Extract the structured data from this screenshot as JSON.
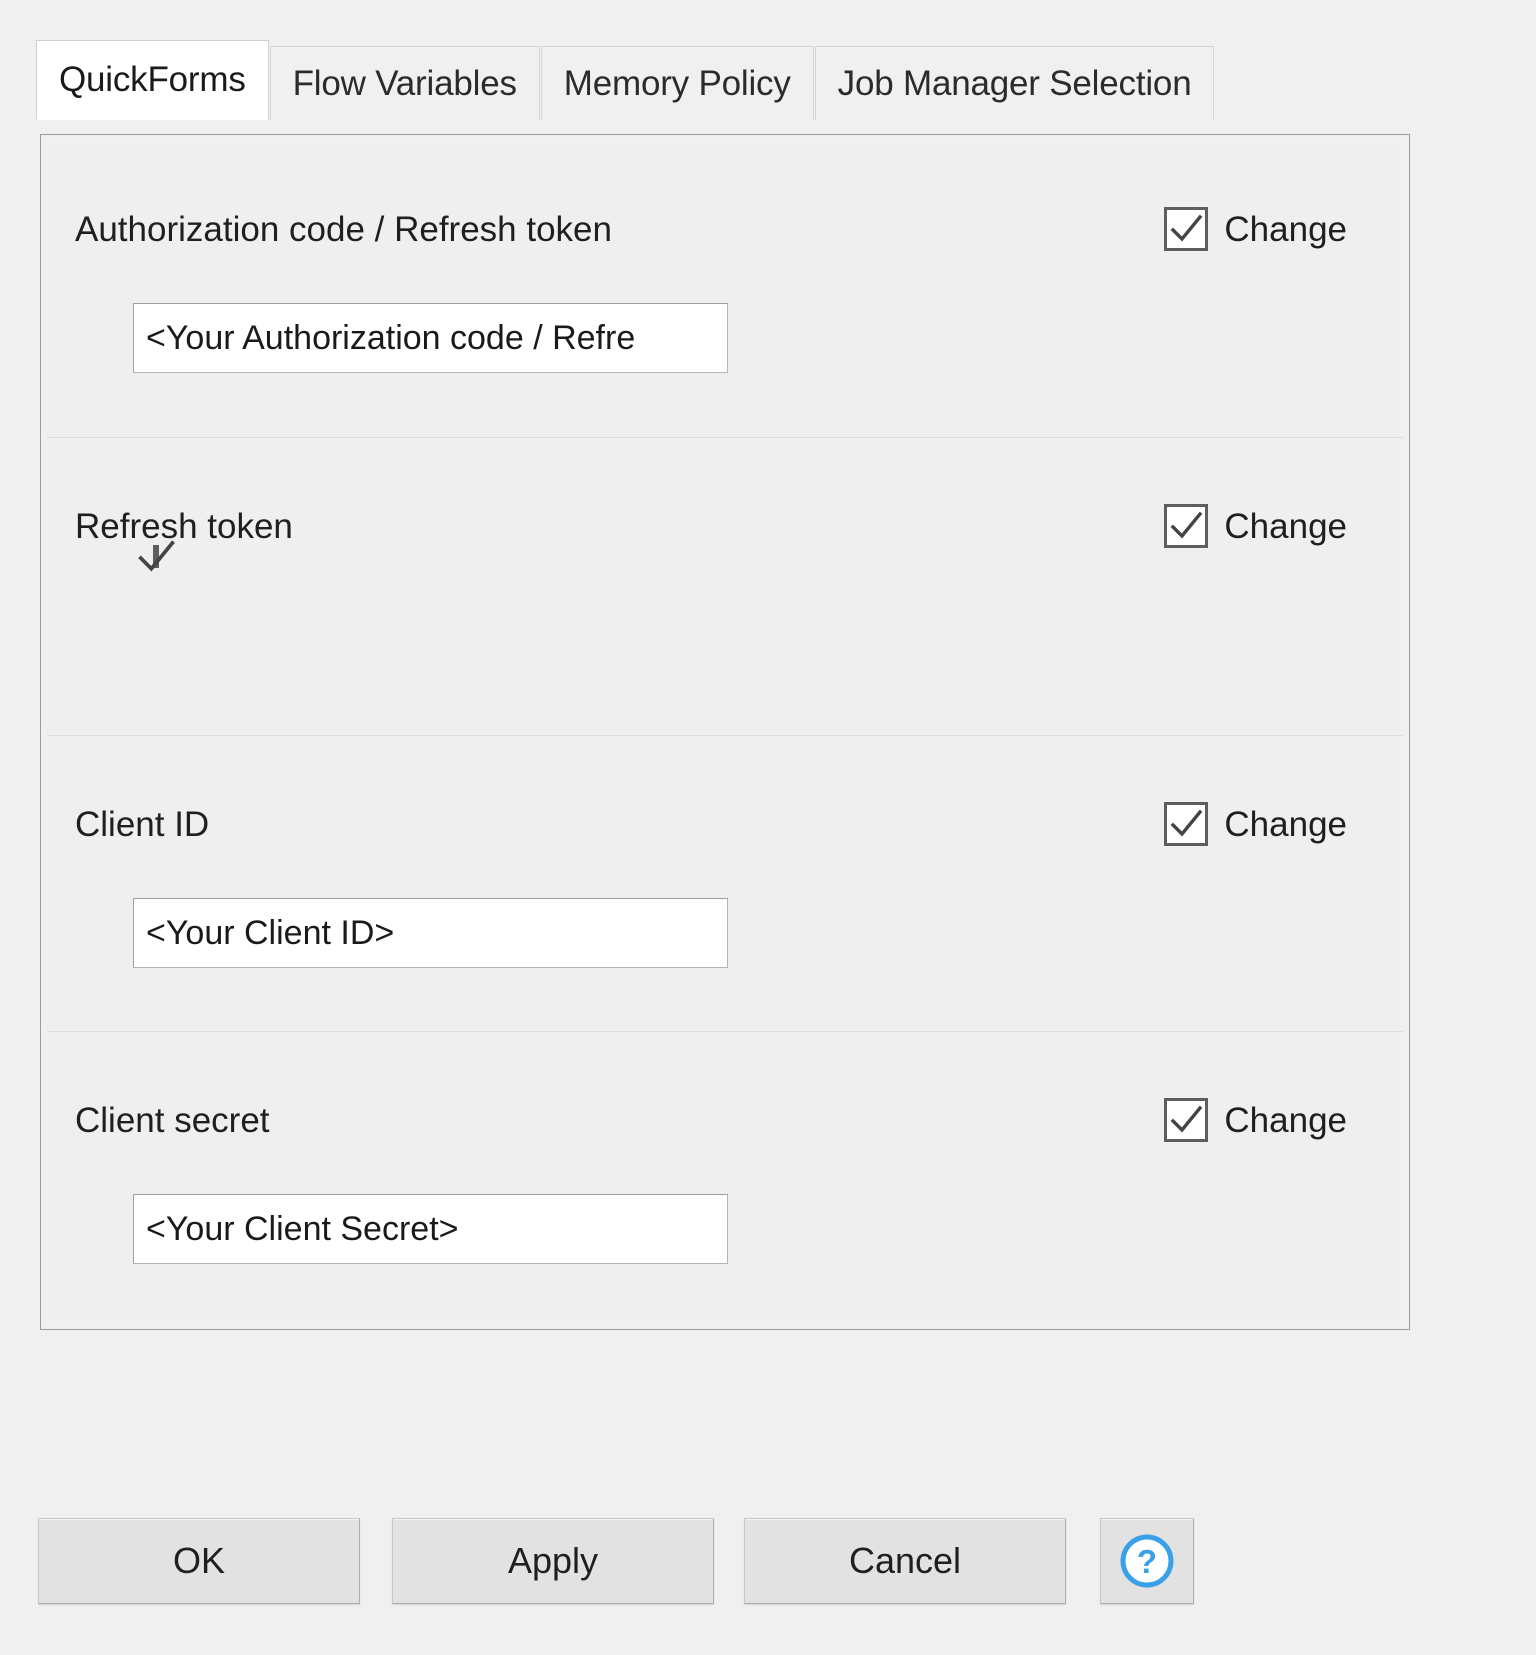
{
  "tabs": [
    {
      "label": "QuickForms",
      "active": true
    },
    {
      "label": "Flow Variables",
      "active": false
    },
    {
      "label": "Memory Policy",
      "active": false
    },
    {
      "label": "Job Manager Selection",
      "active": false
    }
  ],
  "sections": [
    {
      "label": "Authorization code / Refresh token",
      "change_label": "Change",
      "change_checked": true,
      "control": "text",
      "value": "<Your Authorization code / Refre"
    },
    {
      "label": "Refresh token",
      "change_label": "Change",
      "change_checked": true,
      "control": "checkbox",
      "value_checked": true
    },
    {
      "label": "Client ID",
      "change_label": "Change",
      "change_checked": true,
      "control": "text",
      "value": "<Your Client ID>"
    },
    {
      "label": "Client secret",
      "change_label": "Change",
      "change_checked": true,
      "control": "text",
      "value": "<Your Client Secret>"
    }
  ],
  "buttons": {
    "ok": "OK",
    "apply": "Apply",
    "cancel": "Cancel",
    "help_icon": "help-circle-icon"
  },
  "colors": {
    "dialog_bg": "#f0f0f0",
    "panel_border": "#9b9b9b",
    "active_tab_bg": "#ffffff",
    "checkbox_border": "#5e5e5e",
    "help_blue": "#3aa0e8",
    "text": "#1f1f1f"
  }
}
